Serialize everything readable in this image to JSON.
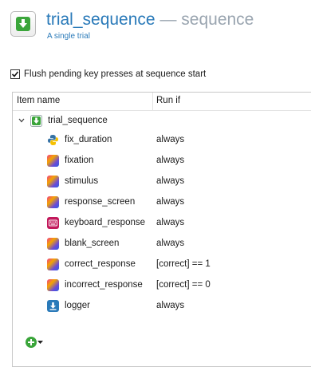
{
  "header": {
    "title_name": "trial_sequence",
    "title_separator": "—",
    "title_type": "sequence",
    "subtitle": "A single trial"
  },
  "options": {
    "flush_label": "Flush pending key presses at sequence start",
    "flush_checked": true
  },
  "tree": {
    "columns": {
      "name": "Item name",
      "run_if": "Run if"
    },
    "root": {
      "name": "trial_sequence",
      "icon": "sequence-icon",
      "expanded": true
    },
    "items": [
      {
        "name": "fix_duration",
        "run_if": "always",
        "icon": "python-icon"
      },
      {
        "name": "fixation",
        "run_if": "always",
        "icon": "sketchpad-icon"
      },
      {
        "name": "stimulus",
        "run_if": "always",
        "icon": "sketchpad-icon"
      },
      {
        "name": "response_screen",
        "run_if": "always",
        "icon": "sketchpad-icon"
      },
      {
        "name": "keyboard_response",
        "run_if": "always",
        "icon": "keyboard-icon"
      },
      {
        "name": "blank_screen",
        "run_if": "always",
        "icon": "sketchpad-icon"
      },
      {
        "name": "correct_response",
        "run_if": "[correct] == 1",
        "icon": "sketchpad-icon"
      },
      {
        "name": "incorrect_response",
        "run_if": "[correct] == 0",
        "icon": "sketchpad-icon"
      },
      {
        "name": "logger",
        "run_if": "always",
        "icon": "logger-icon"
      }
    ]
  },
  "colors": {
    "title": "#2a7ab9",
    "title_muted": "#9aa5b0",
    "sequence_green": "#3aa53a"
  }
}
